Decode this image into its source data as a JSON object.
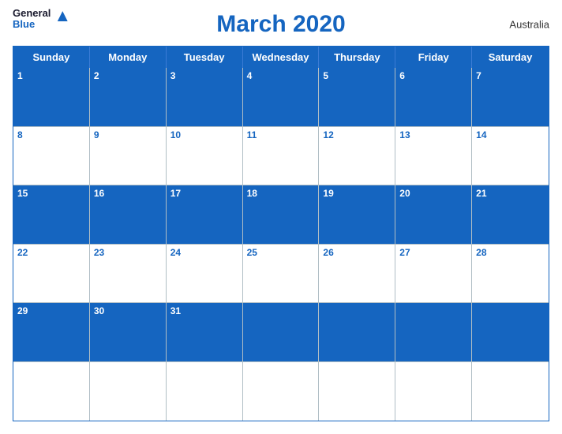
{
  "header": {
    "logo": {
      "general": "General",
      "blue": "Blue",
      "bird_symbol": "▲"
    },
    "title": "March 2020",
    "country": "Australia"
  },
  "weekdays": [
    "Sunday",
    "Monday",
    "Tuesday",
    "Wednesday",
    "Thursday",
    "Friday",
    "Saturday"
  ],
  "weeks": [
    {
      "style": "blue",
      "days": [
        {
          "num": "1",
          "empty": false
        },
        {
          "num": "2",
          "empty": false
        },
        {
          "num": "3",
          "empty": false
        },
        {
          "num": "4",
          "empty": false
        },
        {
          "num": "5",
          "empty": false
        },
        {
          "num": "6",
          "empty": false
        },
        {
          "num": "7",
          "empty": false
        }
      ]
    },
    {
      "style": "white",
      "days": [
        {
          "num": "8",
          "empty": false
        },
        {
          "num": "9",
          "empty": false
        },
        {
          "num": "10",
          "empty": false
        },
        {
          "num": "11",
          "empty": false
        },
        {
          "num": "12",
          "empty": false
        },
        {
          "num": "13",
          "empty": false
        },
        {
          "num": "14",
          "empty": false
        }
      ]
    },
    {
      "style": "blue",
      "days": [
        {
          "num": "15",
          "empty": false
        },
        {
          "num": "16",
          "empty": false
        },
        {
          "num": "17",
          "empty": false
        },
        {
          "num": "18",
          "empty": false
        },
        {
          "num": "19",
          "empty": false
        },
        {
          "num": "20",
          "empty": false
        },
        {
          "num": "21",
          "empty": false
        }
      ]
    },
    {
      "style": "white",
      "days": [
        {
          "num": "22",
          "empty": false
        },
        {
          "num": "23",
          "empty": false
        },
        {
          "num": "24",
          "empty": false
        },
        {
          "num": "25",
          "empty": false
        },
        {
          "num": "26",
          "empty": false
        },
        {
          "num": "27",
          "empty": false
        },
        {
          "num": "28",
          "empty": false
        }
      ]
    },
    {
      "style": "blue",
      "days": [
        {
          "num": "29",
          "empty": false
        },
        {
          "num": "30",
          "empty": false
        },
        {
          "num": "31",
          "empty": false
        },
        {
          "num": "",
          "empty": true
        },
        {
          "num": "",
          "empty": true
        },
        {
          "num": "",
          "empty": true
        },
        {
          "num": "",
          "empty": true
        }
      ]
    },
    {
      "style": "white",
      "days": [
        {
          "num": "",
          "empty": true
        },
        {
          "num": "",
          "empty": true
        },
        {
          "num": "",
          "empty": true
        },
        {
          "num": "",
          "empty": true
        },
        {
          "num": "",
          "empty": true
        },
        {
          "num": "",
          "empty": true
        },
        {
          "num": "",
          "empty": true
        }
      ]
    }
  ]
}
